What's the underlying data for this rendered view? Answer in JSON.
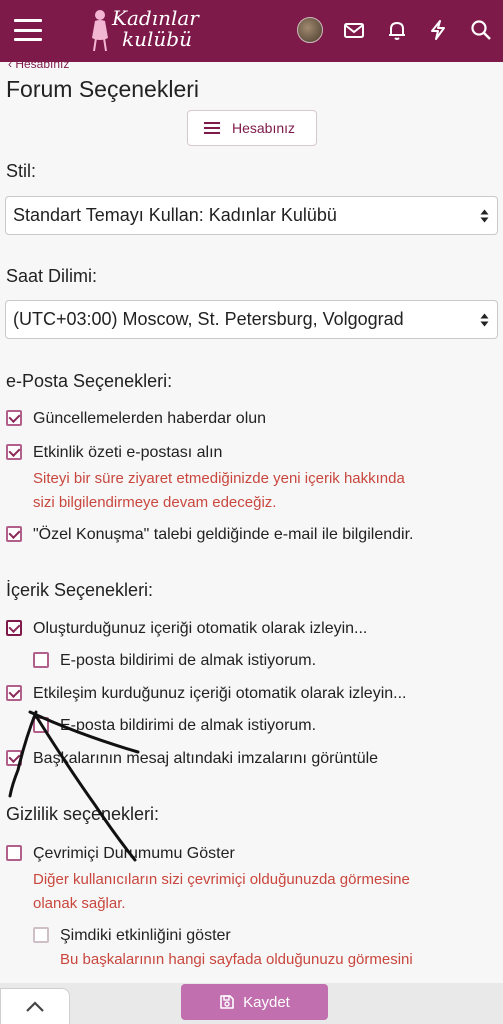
{
  "header": {
    "logo_line1": "Kadınlar",
    "logo_line2": "kulübü",
    "icons": [
      "menu-icon",
      "avatar",
      "envelope-icon",
      "bell-icon",
      "bolt-icon",
      "search-icon"
    ]
  },
  "breadcrumb": "‹ Hesabınız",
  "page": {
    "title": "Forum Seçenekleri",
    "account_button": "Hesabınız"
  },
  "style": {
    "label": "Stil:",
    "selected": "Standart Temayı Kullan: Kadınlar Kulübü"
  },
  "timezone": {
    "label": "Saat Dilimi:",
    "selected": "(UTC+03:00) Moscow, St. Petersburg, Volgograd"
  },
  "email_options": {
    "label": "e-Posta Seçenekleri:",
    "updates": {
      "label": "Güncellemelerden haberdar olun",
      "checked": true
    },
    "digest": {
      "label": "Etkinlik özeti e-postası alın",
      "checked": true,
      "hint_line1": "Siteyi bir süre ziyaret etmediğinizde yeni içerik hakkında",
      "hint_line2": "sizi bilgilendirmeye devam edeceğiz."
    },
    "conversation": {
      "label": "\"Özel Konuşma\" talebi geldiğinde e-mail ile bilgilendir.",
      "checked": true
    }
  },
  "content_options": {
    "label": "İçerik Seçenekleri:",
    "watch_created": {
      "label": "Oluşturduğunuz içeriği otomatik olarak izleyin...",
      "checked": true
    },
    "watch_created_email": {
      "label": "E-posta bildirimi de almak istiyorum.",
      "checked": false
    },
    "watch_interacted": {
      "label": "Etkileşim kurduğunuz içeriği otomatik olarak izleyin...",
      "checked": true
    },
    "watch_interacted_email": {
      "label": "E-posta bildirimi de almak istiyorum.",
      "checked": false
    },
    "signatures": {
      "label": "Başkalarının mesaj altındaki imzalarını görüntüle",
      "checked": true
    }
  },
  "privacy_options": {
    "label": "Gizlilik seçenekleri:",
    "online_status": {
      "label": "Çevrimiçi Durumumu Göster",
      "checked": false,
      "hint_line1": "Diğer kullanıcıların sizi çevrimiçi olduğunuzda görmesine",
      "hint_line2": "olanak sağlar."
    },
    "current_activity": {
      "label": "Şimdiki etkinliğini göster",
      "checked": false,
      "hint_line1": "Bu başkalarının hangi sayfada olduğunuzu görmesini"
    }
  },
  "footer": {
    "save_label": "Kaydet"
  },
  "colors": {
    "brand": "#7e1a4a",
    "accent": "#c16fae",
    "hint": "#c9473e"
  }
}
